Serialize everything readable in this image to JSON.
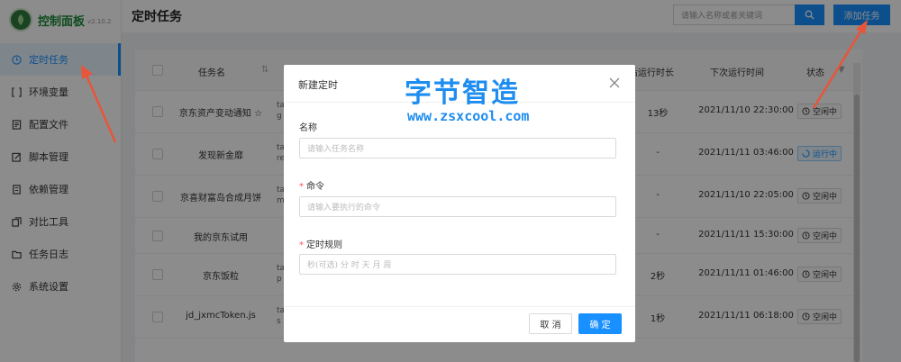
{
  "brand": {
    "name": "控制面板",
    "version": "v2.10.2"
  },
  "sidebar": {
    "items": [
      {
        "label": "定时任务",
        "icon": "clock-icon",
        "active": true
      },
      {
        "label": "环境变量",
        "icon": "variable-icon"
      },
      {
        "label": "配置文件",
        "icon": "config-file-icon"
      },
      {
        "label": "脚本管理",
        "icon": "edit-script-icon"
      },
      {
        "label": "依赖管理",
        "icon": "dependency-icon"
      },
      {
        "label": "对比工具",
        "icon": "diff-icon"
      },
      {
        "label": "任务日志",
        "icon": "folder-icon"
      },
      {
        "label": "系统设置",
        "icon": "gear-icon"
      }
    ]
  },
  "header": {
    "title": "定时任务",
    "search_placeholder": "请输入名称或者关键词",
    "add_label": "添加任务"
  },
  "table": {
    "columns": {
      "name": "任务名",
      "duration": "后运行时长",
      "next_run": "下次运行时间",
      "status": "状态"
    },
    "rows": [
      {
        "name": "京东资产变动通知 ☆",
        "cmd": "ta g",
        "duration": "13秒",
        "next_run": "2021/11/10 22:30:00",
        "status": "空闲中",
        "state": "idle"
      },
      {
        "name": "发现新金靡",
        "cmd": "ta re",
        "duration": "-",
        "next_run": "2021/11/11 03:46:00",
        "status": "运行中",
        "state": "running"
      },
      {
        "name": "京喜财富岛合成月饼",
        "cmd": "ta m",
        "duration": "-",
        "next_run": "2021/11/10 22:05:00",
        "status": "空闲中",
        "state": "idle"
      },
      {
        "name": "我的京东试用",
        "cmd": "",
        "duration": "-",
        "next_run": "2021/11/11 15:30:00",
        "status": "空闲中",
        "state": "idle"
      },
      {
        "name": "京东饭粒",
        "cmd": "ta p",
        "duration": "2秒",
        "next_run": "2021/11/11 01:46:00",
        "status": "空闲中",
        "state": "idle"
      },
      {
        "name": "jd_jxmcToken.js",
        "cmd": "ta s",
        "duration": "1秒",
        "next_run": "2021/11/11 06:18:00",
        "status": "空闲中",
        "state": "idle"
      }
    ]
  },
  "modal": {
    "title": "新建定时",
    "watermark_cn": "字节智造",
    "watermark_url": "www.zsxcool.com",
    "fields": {
      "name": {
        "label": "名称",
        "placeholder": "请输入任务名称"
      },
      "command": {
        "label": "命令",
        "placeholder": "请输入要执行的命令",
        "required": "*"
      },
      "schedule": {
        "label": "定时规则",
        "placeholder": "秒(可选) 分 时 天 月 周",
        "required": "*"
      }
    },
    "cancel_label": "取 消",
    "ok_label": "确 定"
  },
  "colors": {
    "primary": "#1890ff",
    "brand": "#1d8a3a",
    "annotation": "#e8553a",
    "overlay": "rgba(0,0,0,0.45)"
  }
}
